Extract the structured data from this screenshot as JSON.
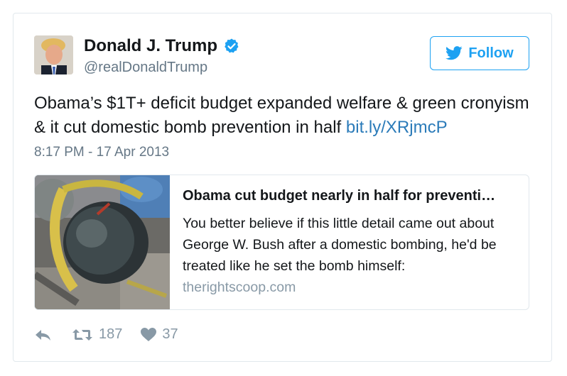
{
  "tweet": {
    "author": {
      "name": "Donald J. Trump",
      "handle": "@realDonaldTrump",
      "verified": true,
      "verified_color": "#1da1f2"
    },
    "follow_label": "Follow",
    "text": "Obama’s $1T+ deficit budget expanded welfare & green cronyism & it cut domestic bomb prevention in half ",
    "link_text": "bit.ly/XRjmcP",
    "timestamp": "8:17 PM - 17 Apr 2013",
    "link_card": {
      "title": "Obama cut budget nearly in half for preventi…",
      "description": "You better believe if this little detail came out about George W. Bush after a domestic bombing, he'd be treated like he set the bomb himself:",
      "domain": "therightscoop.com"
    },
    "actions": {
      "reply_icon": "reply-icon",
      "retweet_icon": "retweet-icon",
      "retweet_count": "187",
      "like_icon": "heart-icon",
      "like_count": "37"
    }
  },
  "colors": {
    "accent": "#1da1f2",
    "link": "#2b7bb9",
    "muted": "#657786",
    "border": "#e1e8ed"
  }
}
